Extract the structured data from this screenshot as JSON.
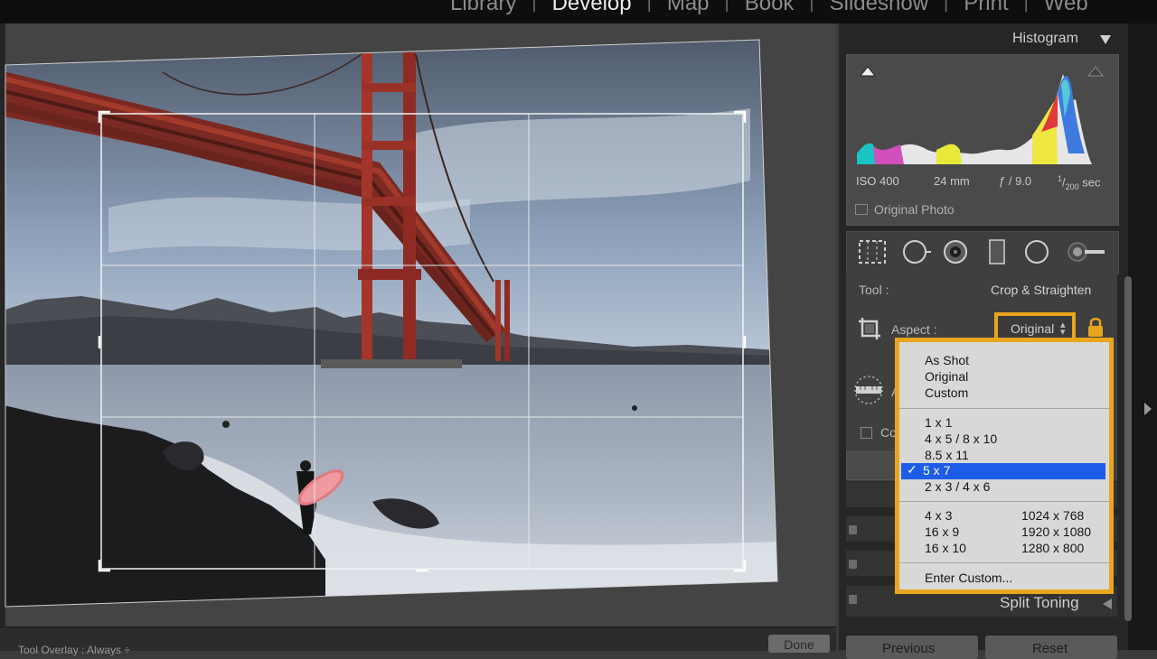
{
  "modules": [
    "Library",
    "Develop",
    "Map",
    "Book",
    "Slideshow",
    "Print",
    "Web"
  ],
  "active_module": "Develop",
  "histogram": {
    "title": "Histogram",
    "iso": "ISO 400",
    "focal": "24 mm",
    "aperture": "ƒ / 9.0",
    "shutter_num": "1",
    "shutter_den": "200",
    "shutter_unit": "sec",
    "original_photo": "Original Photo"
  },
  "tool_panel": {
    "tool_label": "Tool :",
    "tool_value": "Crop & Straighten",
    "aspect_label": "Aspect :",
    "aspect_value": "Original",
    "angle_fragment": "A",
    "constrain_fragment": "Co"
  },
  "aspect_menu": {
    "group1": [
      "As Shot",
      "Original",
      "Custom"
    ],
    "group2": [
      "1 x 1",
      "4 x 5  /  8 x 10",
      "8.5 x 11",
      "5 x 7",
      "2 x 3  /  4 x 6"
    ],
    "selected": "5 x 7",
    "group3": [
      {
        "label": "4 x 3",
        "size": "1024 x 768"
      },
      {
        "label": "16 x 9",
        "size": "1920 x 1080"
      },
      {
        "label": "16 x 10",
        "size": "1280 x 800"
      }
    ],
    "enter_custom": "Enter Custom..."
  },
  "panels": {
    "split_toning": "Split Toning"
  },
  "buttons": {
    "previous": "Previous",
    "reset": "Reset",
    "done": "Done"
  },
  "toolbar": {
    "label": "Tool Overlay :  Always ÷"
  },
  "colors": {
    "accent_highlight": "#e9a51c",
    "selection_blue": "#1c5ce6"
  }
}
